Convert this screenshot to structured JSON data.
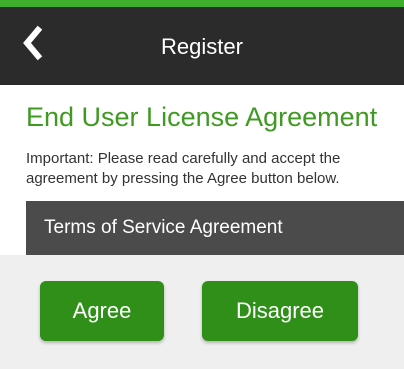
{
  "app_bar": {
    "title": "Register",
    "back_icon": "chevron-left-icon",
    "background": "#2b2b2b",
    "accent": "#3fae2a"
  },
  "eula": {
    "title": "End User License Agreement",
    "description": "Important: Please read carefully and accept the agreement by pressing the Agree button below.",
    "title_color": "#3f9a22"
  },
  "terms": {
    "label": "Terms of Service Agreement"
  },
  "footer": {
    "agree_label": "Agree",
    "disagree_label": "Disagree",
    "button_color": "#2f8f19"
  }
}
